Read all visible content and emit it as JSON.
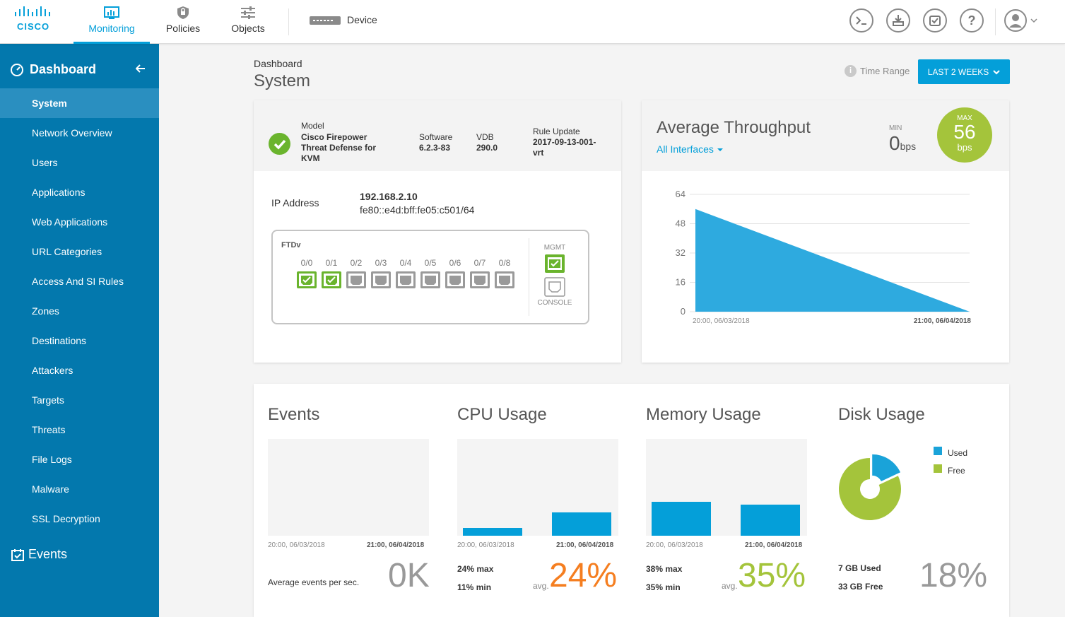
{
  "topnav": {
    "brand": "CISCO",
    "tabs": [
      {
        "label": "Monitoring",
        "icon": "monitoring-icon",
        "active": true
      },
      {
        "label": "Policies",
        "icon": "policies-shield-icon"
      },
      {
        "label": "Objects",
        "icon": "objects-sliders-icon"
      }
    ],
    "device_label": "Device",
    "right_icons": [
      "terminal-icon",
      "deploy-icon",
      "tasks-icon",
      "help-icon",
      "user-avatar-icon"
    ]
  },
  "sidebar": {
    "header": "Dashboard",
    "items": [
      {
        "label": "System",
        "active": true
      },
      {
        "label": "Network Overview"
      },
      {
        "label": "Users"
      },
      {
        "label": "Applications"
      },
      {
        "label": "Web Applications"
      },
      {
        "label": "URL Categories"
      },
      {
        "label": "Access And SI Rules"
      },
      {
        "label": "Zones"
      },
      {
        "label": "Destinations"
      },
      {
        "label": "Attackers"
      },
      {
        "label": "Targets"
      },
      {
        "label": "Threats"
      },
      {
        "label": "File Logs"
      },
      {
        "label": "Malware"
      },
      {
        "label": "SSL Decryption"
      }
    ],
    "events_label": "Events"
  },
  "header": {
    "breadcrumb": "Dashboard",
    "title": "System",
    "time_range_label": "Time Range",
    "time_range_value": "LAST 2 WEEKS"
  },
  "device_info": {
    "model_label": "Model",
    "model_value": [
      "Cisco Firepower",
      "Threat Defense for",
      "KVM"
    ],
    "software_label": "Software",
    "software_value": "6.2.3-83",
    "vdb_label": "VDB",
    "vdb_value": "290.0",
    "rule_update_label": "Rule Update",
    "rule_update_value": [
      "2017-09-13-001-",
      "vrt"
    ],
    "ip_label": "IP Address",
    "ipv4": "192.168.2.10",
    "ipv6": "fe80::e4d:bff:fe05:c501/64",
    "chassis_title": "FTDv",
    "ports": [
      {
        "label": "0/0",
        "up": true
      },
      {
        "label": "0/1",
        "up": true
      },
      {
        "label": "0/2",
        "up": false
      },
      {
        "label": "0/3",
        "up": false
      },
      {
        "label": "0/4",
        "up": false
      },
      {
        "label": "0/5",
        "up": false
      },
      {
        "label": "0/6",
        "up": false
      },
      {
        "label": "0/7",
        "up": false
      },
      {
        "label": "0/8",
        "up": false
      }
    ],
    "mgmt_label": "MGMT",
    "console_label": "CONSOLE"
  },
  "throughput": {
    "title": "Average Throughput",
    "filter": "All Interfaces",
    "min_label": "MIN",
    "min_value": "0",
    "min_unit": "bps",
    "max_label": "MAX",
    "max_value": "56",
    "max_unit": "bps"
  },
  "chart_data": {
    "type": "area",
    "x": [
      "20:00, 06/03/2018",
      "21:00, 06/04/2018"
    ],
    "y": [
      56,
      0
    ],
    "y_ticks": [
      "64",
      "48",
      "32",
      "16",
      "0"
    ],
    "ylim": [
      0,
      64
    ],
    "grid": true,
    "x_start_label": "20:00, 06/03/2018",
    "x_end_label": "21:00, 06/04/2018"
  },
  "events": {
    "title": "Events",
    "x_start": "20:00, 06/03/2018",
    "x_end": "21:00, 06/04/2018",
    "caption": "Average events per sec.",
    "value": "0K"
  },
  "cpu": {
    "title": "CPU Usage",
    "x_start": "20:00, 06/03/2018",
    "x_end": "21:00, 06/04/2018",
    "bars_pct": [
      8,
      24
    ],
    "max_text": "24% max",
    "min_text": "11% min",
    "avg_label": "avg.",
    "value": "24%"
  },
  "memory": {
    "title": "Memory Usage",
    "x_start": "20:00, 06/03/2018",
    "x_end": "21:00, 06/04/2018",
    "bars_pct": [
      35,
      32
    ],
    "max_text": "38% max",
    "min_text": "35% min",
    "avg_label": "avg.",
    "value": "35%"
  },
  "disk": {
    "title": "Disk Usage",
    "used_pct": 18,
    "legend_used": "Used",
    "legend_free": "Free",
    "used_text": "7 GB Used",
    "free_text": "33 GB Free",
    "value": "18%"
  },
  "colors": {
    "accent": "#049fd9",
    "sidebar": "#0378ad",
    "green": "#a4c43b",
    "cpu_orange": "#f57e20",
    "ok_green": "#6ab42d"
  }
}
